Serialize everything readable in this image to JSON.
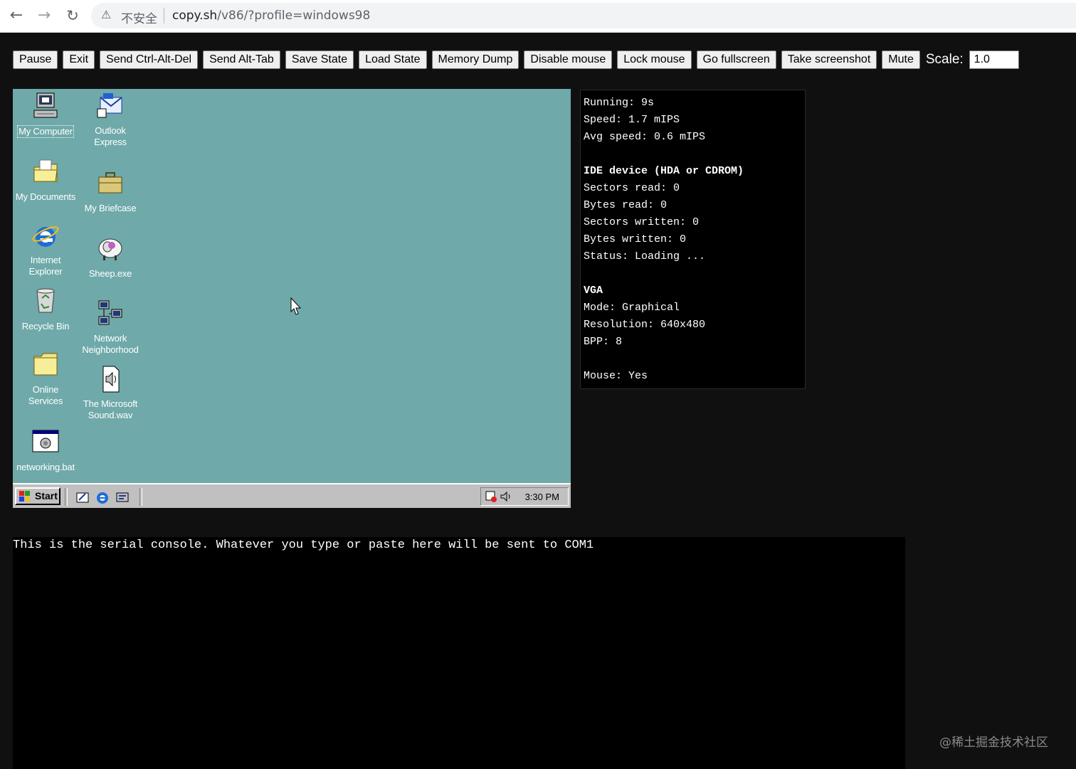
{
  "browser": {
    "security_label": "不安全",
    "url_host": "copy.sh",
    "url_path": "/v86/?profile=windows98",
    "icons": {
      "back": "back-arrow-icon",
      "forward": "forward-arrow-icon",
      "reload": "reload-icon",
      "security": "warning-triangle-icon"
    }
  },
  "toolbar": {
    "buttons": [
      "Pause",
      "Exit",
      "Send Ctrl-Alt-Del",
      "Send Alt-Tab",
      "Save State",
      "Load State",
      "Memory Dump",
      "Disable mouse",
      "Lock mouse",
      "Go fullscreen",
      "Take screenshot",
      "Mute"
    ],
    "scale_label": "Scale:",
    "scale_value": "1.0"
  },
  "desktop": {
    "background": "#6fa9a9",
    "icons": [
      {
        "label": "My Computer",
        "icon": "my-computer-icon",
        "selected": true
      },
      {
        "label": "Outlook Express",
        "icon": "outlook-express-icon"
      },
      {
        "label": "My Documents",
        "icon": "folder-icon"
      },
      {
        "label": "My Briefcase",
        "icon": "briefcase-icon"
      },
      {
        "label": "Internet Explorer",
        "icon": "internet-explorer-icon"
      },
      {
        "label": "Sheep.exe",
        "icon": "sheep-icon"
      },
      {
        "label": "Recycle Bin",
        "icon": "recycle-bin-icon"
      },
      {
        "label": "Network Neighborhood",
        "icon": "network-icon"
      },
      {
        "label": "Online Services",
        "icon": "folder-icon"
      },
      {
        "label": "The Microsoft Sound.wav",
        "icon": "sound-file-icon"
      },
      {
        "label": "networking.bat",
        "icon": "batch-file-icon"
      }
    ],
    "taskbar": {
      "start_label": "Start",
      "clock": "3:30 PM",
      "quick_launch": [
        "show-desktop-icon",
        "internet-explorer-icon",
        "channels-icon"
      ],
      "tray": [
        "scheduler-icon",
        "volume-icon"
      ]
    }
  },
  "stats": {
    "running": "Running: 9s",
    "speed": "Speed: 1.7 mIPS",
    "avg_speed": "Avg speed: 0.6 mIPS",
    "ide_title": "IDE device (HDA or CDROM)",
    "sectors_read": "Sectors read: 0",
    "bytes_read": "Bytes read: 0",
    "sectors_written": "Sectors written: 0",
    "bytes_written": "Bytes written: 0",
    "status": "Status: Loading ...",
    "vga_title": "VGA",
    "mode": "Mode: Graphical",
    "resolution": "Resolution: 640x480",
    "bpp": "BPP: 8",
    "mouse": "Mouse: Yes"
  },
  "serial": {
    "text": "This is the serial console. Whatever you type or paste here will be sent to COM1"
  },
  "watermark": "@稀土掘金技术社区"
}
